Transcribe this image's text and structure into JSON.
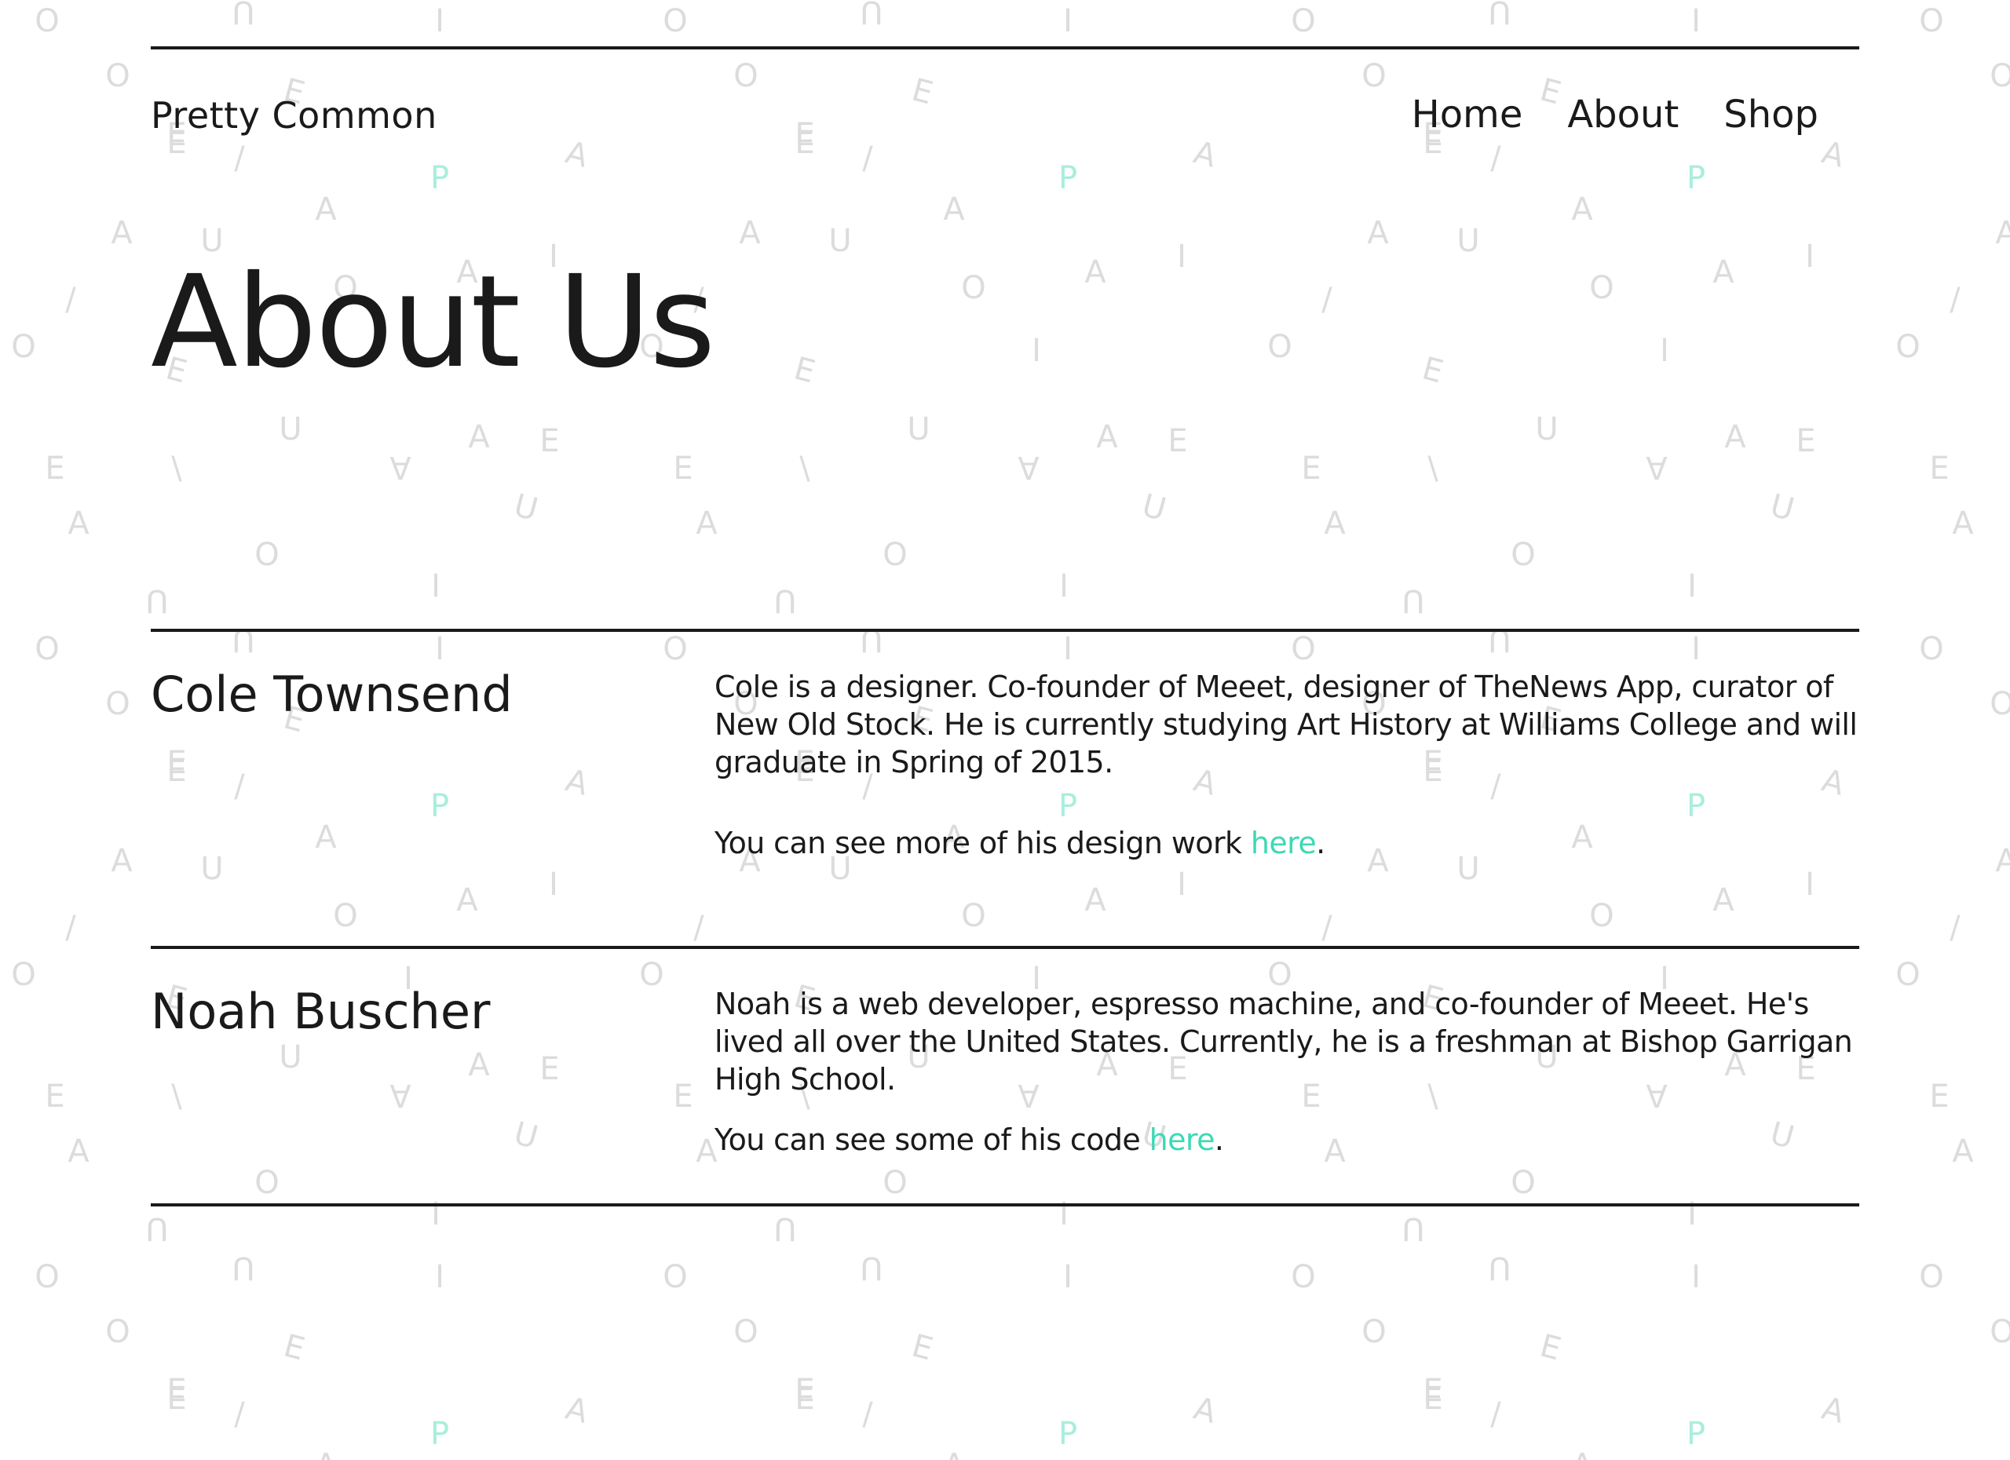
{
  "header": {
    "logo": "Pretty Common",
    "nav": [
      "Home",
      "About",
      "Shop"
    ]
  },
  "page_title": "About Us",
  "people": [
    {
      "name": "Cole Townsend",
      "bio": "Cole is a designer. Co-founder of Meeet, designer of TheNews App, curator of New Old Stock. He is currently studying Art History at Williams College and will graduate in Spring of 2015.",
      "more_prefix": "You can see more of his design work ",
      "link_label": "here",
      "more_suffix": "."
    },
    {
      "name": "Noah Buscher",
      "bio": "Noah is a web developer, espresso machine, and co-founder of Meeet. He's lived all over the United States. Currently, he is a freshman at Bishop Garrigan High School.",
      "more_prefix": "You can see some of his code ",
      "link_label": "here",
      "more_suffix": "."
    }
  ],
  "colors": {
    "text": "#1a1a1a",
    "accent": "#3dd9b5",
    "pattern_letters": "#dcdcdc",
    "pattern_accent": "#a8eedd"
  }
}
